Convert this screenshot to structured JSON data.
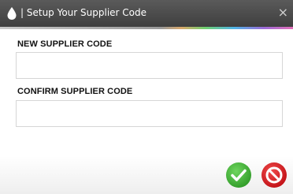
{
  "dialog": {
    "title": "| Setup Your Supplier Code",
    "close_label": "×"
  },
  "form": {
    "new_code_label": "NEW SUPPLIER CODE",
    "new_code_value": "",
    "confirm_code_label": "CONFIRM SUPPLIER CODE",
    "confirm_code_value": ""
  },
  "icons": {
    "app": "water-drop-icon",
    "confirm": "checkmark-icon",
    "cancel": "prohibited-icon"
  },
  "colors": {
    "titlebar": "#4a4a4a",
    "confirm_green": "#35a72d",
    "cancel_red": "#d4161c"
  }
}
